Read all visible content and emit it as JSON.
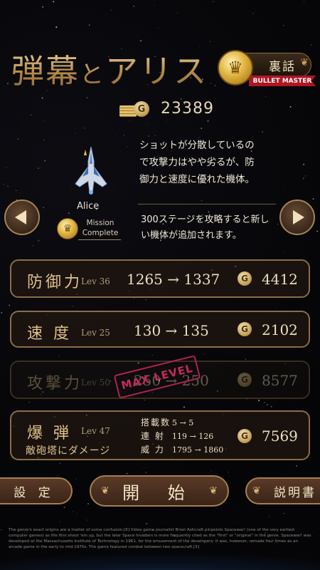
{
  "title": {
    "main": "弾幕",
    "connector": "と",
    "rest": "アリス"
  },
  "secret_badge": {
    "label": "裏話",
    "ribbon": "BULLET MASTER",
    "icon": "crown-icon"
  },
  "gold": {
    "icon": "gold-coins-icon",
    "coin_glyph": "G",
    "amount": "23389"
  },
  "ship": {
    "name": "Alice",
    "icon": "fighter-ship-icon"
  },
  "mission": {
    "line1": "Mission",
    "line2": "Complete",
    "icon": "crown-crest-icon"
  },
  "description": [
    "ショットが分散しているの",
    "で攻撃力はやや劣るが、防",
    "御力と速度に優れた機体。"
  ],
  "unlock_note": [
    "300ステージを攻略すると新し",
    "い機体が追加されます。"
  ],
  "stats": [
    {
      "name": "防御力",
      "level": "Lev 36",
      "change": "1265 → 1337",
      "cost": "4412"
    },
    {
      "name": "速 度",
      "level": "Lev 25",
      "change": "130 → 135",
      "cost": "2102"
    },
    {
      "name": "攻撃力",
      "level": "Lev 50",
      "change": "250 → 250",
      "cost": "8577",
      "badge": "MAX LEVEL"
    }
  ],
  "bomb": {
    "name": "爆 弾",
    "level": "Lev 47",
    "subtitle": "敵砲塔にダメージ",
    "rows": [
      {
        "key": "搭載数",
        "value": "5 → 5"
      },
      {
        "key": "連 射",
        "value": "119 → 126"
      },
      {
        "key": "威 力",
        "value": "1795 → 1860"
      }
    ],
    "cost": "7569"
  },
  "buttons": {
    "settings": "設 定",
    "start": "開 始",
    "manual": "説明書"
  },
  "fineprint": "The genre's exact origins are a matter of some confusion.[6] Video game journalist Brian Ashcraft pinpoints Spacewar! (one of the very earliest computer games) as the first shoot 'em up, but the later Space Invaders is more frequently cited as the \"first\" or \"original\" in the genre. Spacewar! was developed at the Massachusetts Institute of Technology in 1961, for the amusement of the developers; it was, however, remade four times as an arcade game in the early to mid-1970s. The game featured combat between two spacecraft.[3]",
  "colors": {
    "gold_text": "#c9a66a",
    "panel_border": "#8a6d46",
    "stamp": "#c62a5c",
    "ribbon": "#b01522"
  }
}
